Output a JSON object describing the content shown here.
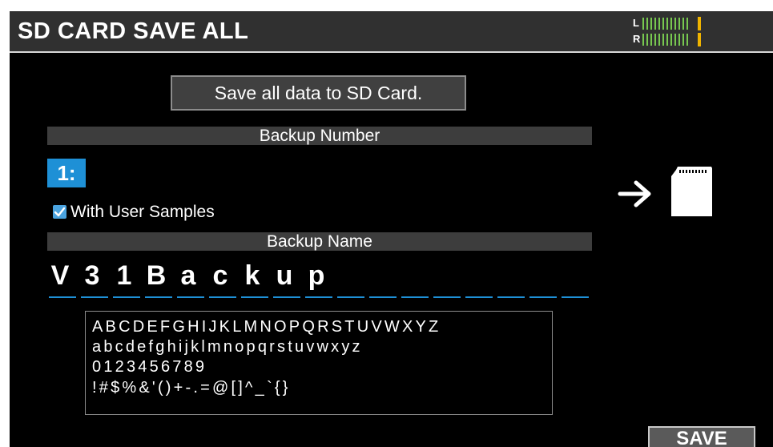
{
  "header": {
    "title": "SD CARD SAVE ALL"
  },
  "level_meter": {
    "left_label": "L",
    "right_label": "R",
    "bar_color": "#78c850",
    "peak_color": "#f0b400"
  },
  "message": "Save all data to SD Card.",
  "backup_number": {
    "header": "Backup Number",
    "value": "1:"
  },
  "user_samples": {
    "label": "With User Samples",
    "checked": true
  },
  "backup_name": {
    "header": "Backup Name",
    "characters": [
      "V",
      "3",
      "1",
      "B",
      "a",
      "c",
      "k",
      "u",
      "p",
      "",
      "",
      "",
      "",
      "",
      "",
      "",
      ""
    ]
  },
  "char_palette": {
    "rows": [
      "ABCDEFGHIJKLMNOPQRSTUVWXYZ",
      "abcdefghijklmnopqrstuvwxyz",
      "0123456789",
      "!#$%&'()+-.=@[]^_`{}"
    ]
  },
  "transfer": {
    "arrow_icon": "arrow-right-icon",
    "card_icon": "sd-card-icon"
  },
  "footer": {
    "save_label": "SAVE"
  },
  "colors": {
    "accent": "#1e90d6",
    "checkbox": "#4aa3df",
    "header_bar": "#303030"
  }
}
